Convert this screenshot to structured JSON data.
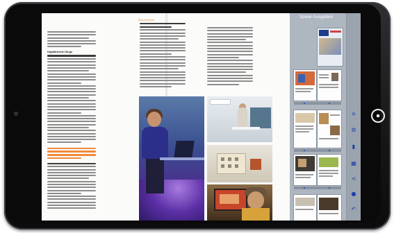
{
  "sidebar": {
    "title": "Spiele Ausgaben",
    "thumbnail_count": 9
  },
  "article": {
    "left_heading": "Digitalisierte Dinge",
    "right_kicker": "Bildung Besser",
    "orange_pullquote": "Die Digitalisierung"
  },
  "icons": [
    "home-icon",
    "settings-icon",
    "bookmark-icon",
    "grid-icon",
    "share-icon",
    "info-icon",
    "back-icon"
  ],
  "colors": {
    "accent": "#f08a3a",
    "sidebar": "#aeb6c0",
    "icon": "#1f3fa8"
  }
}
